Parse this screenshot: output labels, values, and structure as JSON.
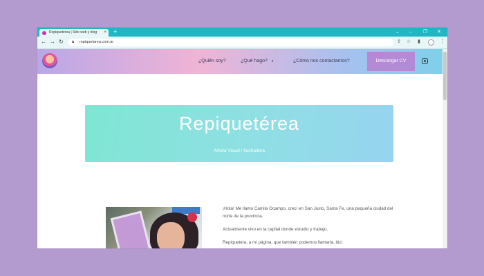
{
  "browser": {
    "tab_title": "Repiquetérea | Sitio web y blog",
    "tab_close": "×",
    "new_tab": "+",
    "url": "repiquetarea.com.ar",
    "window_controls": [
      "⌄",
      "–",
      "❐",
      "✕"
    ]
  },
  "header": {
    "nav": [
      {
        "label": "¿Quién soy?"
      },
      {
        "label": "¿Qué hago?",
        "caret": "▾"
      },
      {
        "label": "¿Cómo nos contactamos?"
      }
    ],
    "cta": "Descargar CV"
  },
  "hero": {
    "title": "Repiquetérea",
    "subtitle": "Artista Visual / Ilustradora"
  },
  "bio": {
    "p1": "¡Hola! Me llamo Camila Ocampo, crecí en San Justo, Santa Fe, una pequeña ciudad del norte de la provincia.",
    "p2": "Actualmente vivo en la capital donde estudio y trabajo.",
    "p3": "Repiquetera, a mi página, que también podemos llamarla, bici"
  },
  "colors": {
    "tabbar": "#1bb9c4",
    "cta": "#b489d6",
    "hero_start": "#7fe6d3",
    "hero_end": "#96d4f0",
    "backdrop": "#b39bd0"
  },
  "icons": [
    "back-arrow-icon",
    "forward-arrow-icon",
    "reload-icon",
    "lock-icon",
    "share-icon",
    "star-icon",
    "sidebar-icon",
    "menu-icon",
    "instagram-icon"
  ]
}
